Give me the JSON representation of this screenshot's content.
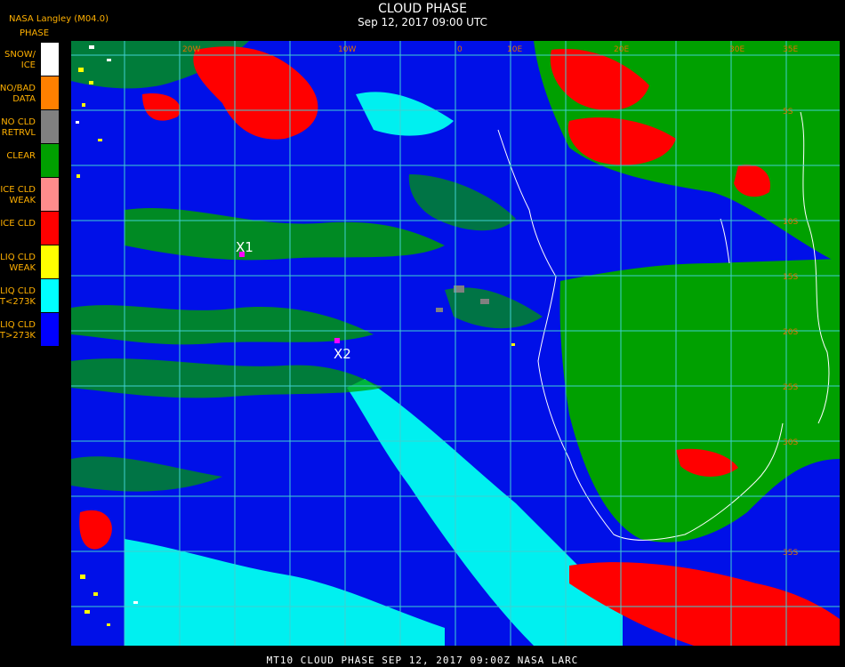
{
  "header": {
    "credit": "NASA Langley (M04.0)",
    "title": "CLOUD PHASE",
    "subtitle": "Sep 12, 2017 09:00 UTC"
  },
  "legend": {
    "title": "PHASE",
    "items": [
      {
        "label": "SNOW/\nICE",
        "color": "#ffffff"
      },
      {
        "label": "NO/BAD\nDATA",
        "color": "#ff8000"
      },
      {
        "label": "NO CLD\nRETRVL",
        "color": "#808080"
      },
      {
        "label": "CLEAR",
        "color": "#00a000"
      },
      {
        "label": "ICE CLD\nWEAK",
        "color": "#ff8c8c"
      },
      {
        "label": "ICE CLD",
        "color": "#ff0000"
      },
      {
        "label": "LIQ CLD\nWEAK",
        "color": "#ffff00"
      },
      {
        "label": "LIQ CLD\nT<273K",
        "color": "#00ffff"
      },
      {
        "label": "LIQ CLD\nT>273K",
        "color": "#0000ff"
      }
    ]
  },
  "map": {
    "markers": [
      {
        "label": "X1",
        "color": "#ff00ff"
      },
      {
        "label": "X2",
        "color": "#ff00ff"
      }
    ],
    "grid_color": "#40d0d0",
    "longitude_labels": [
      "20W",
      "10W",
      "0",
      "10E",
      "20E",
      "30E",
      "35E"
    ],
    "latitude_labels": [
      "5S",
      "10S",
      "15S",
      "20S",
      "25S",
      "30S",
      "35S"
    ]
  },
  "footer": {
    "text": "MT10  CLOUD PHASE   SEP 12, 2017 09:00Z   NASA LARC"
  }
}
